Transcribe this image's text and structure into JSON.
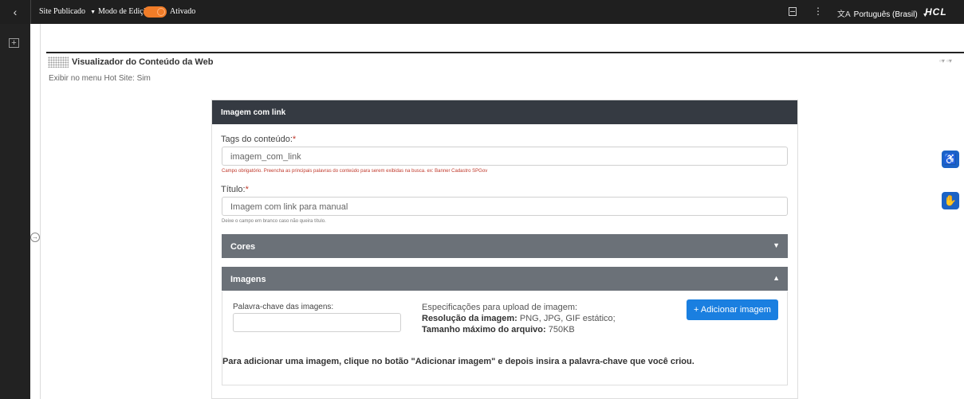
{
  "topbar": {
    "back_icon": "‹",
    "site_label": "Site Publicado",
    "edit_mode_label": "Modo de Edição:",
    "edit_mode_state": "Ativado",
    "language": "Português (Brasil)",
    "translate_icon": "文A",
    "logo": "HCL",
    "accent_color": "#f07c28"
  },
  "rail": {
    "add_icon": "+"
  },
  "portlet": {
    "title": "Visualizador do Conteúdo da Web",
    "actions": "▫▾ ▫▾",
    "hot_site_text": "Exibir no menu Hot Site: Sim"
  },
  "form": {
    "header": "Imagem com link",
    "tags_label": "Tags do conteúdo:",
    "required_mark": "*",
    "tags_value": "imagem_com_link",
    "tags_hint": "Campo obrigatório. Preencha as principais palavras do conteúdo para serem exibidas na busca. ex: Banner Cadastro SPGov",
    "title_label": "Título:",
    "title_value": "Imagem com link para manual",
    "title_hint": "Deixe o campo em branco caso não queira título.",
    "colors_section": "Cores",
    "images_section": "Imagens",
    "images_keyword_label": "Palavra-chave das imagens:",
    "images_keyword_value": "",
    "specs_title": "Especificações para upload de imagem:",
    "specs_resolution_label": "Resolução da imagem:",
    "specs_resolution_value": " PNG, JPG, GIF estático;",
    "specs_size_label": "Tamanho máximo do arquivo:",
    "specs_size_value": " 750KB",
    "add_image_button": "+ Adicionar imagem",
    "instruction": "Para adicionar uma imagem, clique no botão \"Adicionar imagem\" e depois insira a palavra-chave que você criou."
  },
  "accessibility": {
    "icon_a": "accessibility-icon",
    "icon_b": "sign-language-icon",
    "color": "#1b63c6"
  }
}
